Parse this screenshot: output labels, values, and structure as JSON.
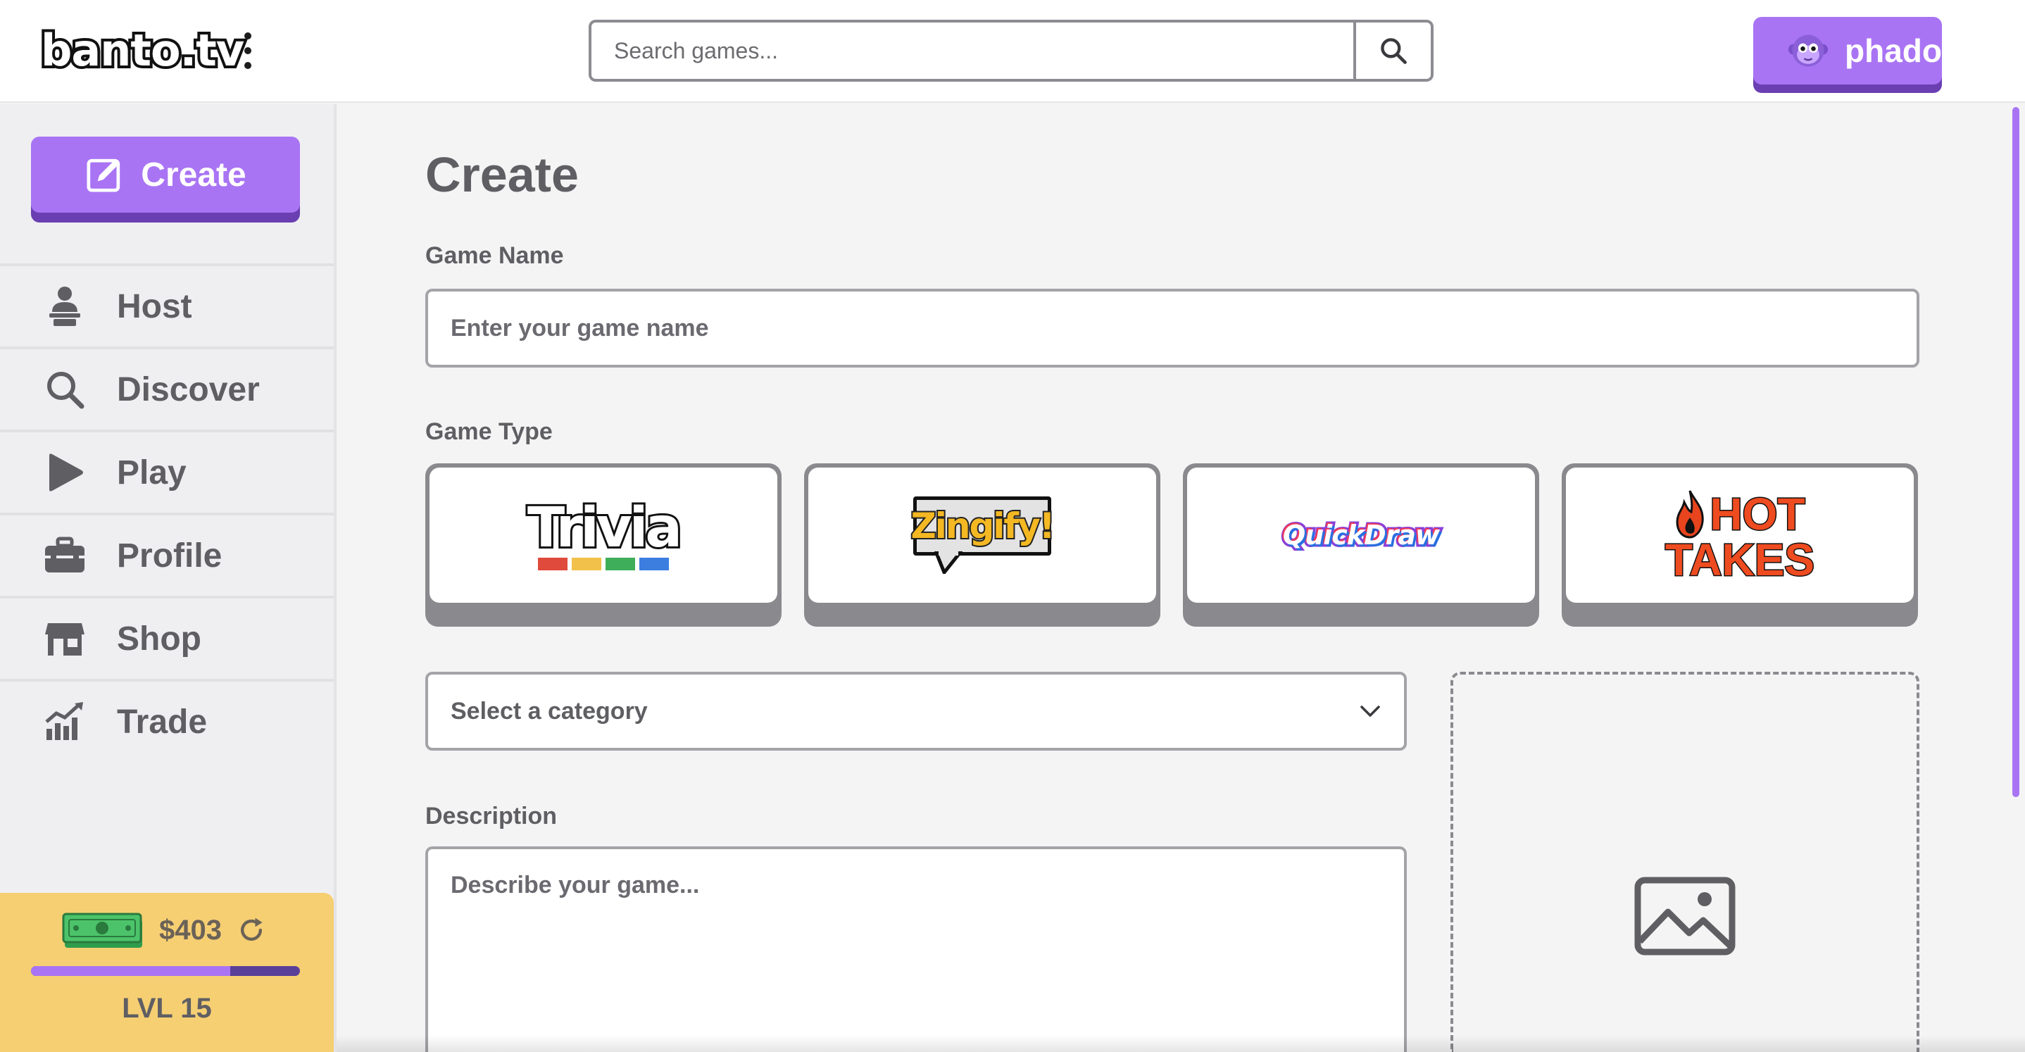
{
  "header": {
    "logo": "banto.tv",
    "search": {
      "placeholder": "Search games...",
      "value": ""
    },
    "user": {
      "name": "phado",
      "avatar": "purple-monkey-avatar"
    }
  },
  "sidebar": {
    "create_label": "Create",
    "items": [
      {
        "label": "Host",
        "icon": "host-person-icon"
      },
      {
        "label": "Discover",
        "icon": "search-icon"
      },
      {
        "label": "Play",
        "icon": "play-icon"
      },
      {
        "label": "Profile",
        "icon": "briefcase-icon"
      },
      {
        "label": "Shop",
        "icon": "store-icon"
      },
      {
        "label": "Trade",
        "icon": "chart-icon"
      }
    ],
    "wallet": {
      "balance": "$403",
      "level": "LVL 15",
      "xp_progress": 0.74
    }
  },
  "main": {
    "title": "Create",
    "game_name": {
      "label": "Game Name",
      "placeholder": "Enter your game name",
      "value": ""
    },
    "game_type": {
      "label": "Game Type",
      "options": [
        {
          "name": "Trivia",
          "logo": "trivia-logo"
        },
        {
          "name": "Zingify!",
          "logo": "zingify-logo"
        },
        {
          "name": "QuickDraw",
          "logo": "quickdraw-logo"
        },
        {
          "name": "HOT TAKES",
          "line1": "HOT",
          "line2": "TAKES",
          "logo": "hot-takes-logo"
        }
      ]
    },
    "category": {
      "selected": "Select a category"
    },
    "description": {
      "label": "Description",
      "placeholder": "Describe your game...",
      "value": ""
    },
    "image_upload": {
      "icon": "image-icon"
    }
  },
  "colors": {
    "accent": "#a974f4",
    "accent_dark": "#6a3fb2",
    "wallet_bg": "#f6cf73",
    "text": "#5f5f63"
  }
}
